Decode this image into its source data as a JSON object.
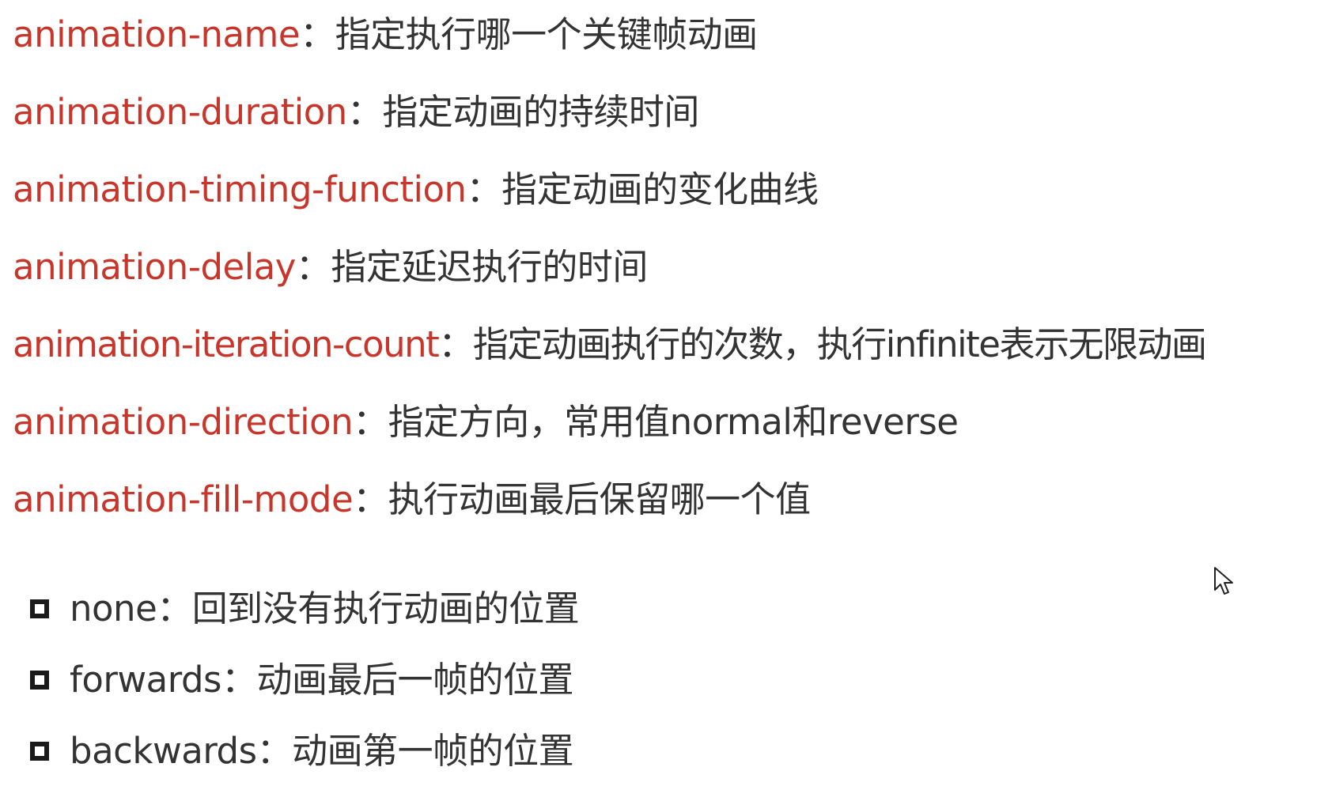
{
  "properties": [
    {
      "name": "animation-name",
      "sep": "：",
      "desc": "指定执行哪一个关键帧动画"
    },
    {
      "name": "animation-duration",
      "sep": "：",
      "desc": "指定动画的持续时间"
    },
    {
      "name": "animation-timing-function",
      "sep": "：",
      "desc": "指定动画的变化曲线"
    },
    {
      "name": "animation-delay",
      "sep": "：",
      "desc": "指定延迟执行的时间"
    },
    {
      "name": "animation-iteration-count",
      "sep": "：",
      "desc": "指定动画执行的次数，执行infinite表示无限动画"
    },
    {
      "name": "animation-direction",
      "sep": "：",
      "desc": "指定方向，常用值normal和reverse"
    },
    {
      "name": "animation-fill-mode",
      "sep": "：",
      "desc": "执行动画最后保留哪一个值"
    }
  ],
  "fill_mode_values": [
    {
      "value": "none",
      "sep": "：",
      "desc": "回到没有执行动画的位置"
    },
    {
      "value": "forwards",
      "sep": "：",
      "desc": "动画最后一帧的位置"
    },
    {
      "value": "backwards",
      "sep": "：",
      "desc": "动画第一帧的位置"
    }
  ],
  "colors": {
    "property": "#c8352a",
    "text": "#333333",
    "bullet": "#1a1a1a",
    "background": "#ffffff"
  },
  "icons": {
    "bullet": "hollow-square-bullet-icon",
    "cursor": "mouse-pointer-icon"
  }
}
